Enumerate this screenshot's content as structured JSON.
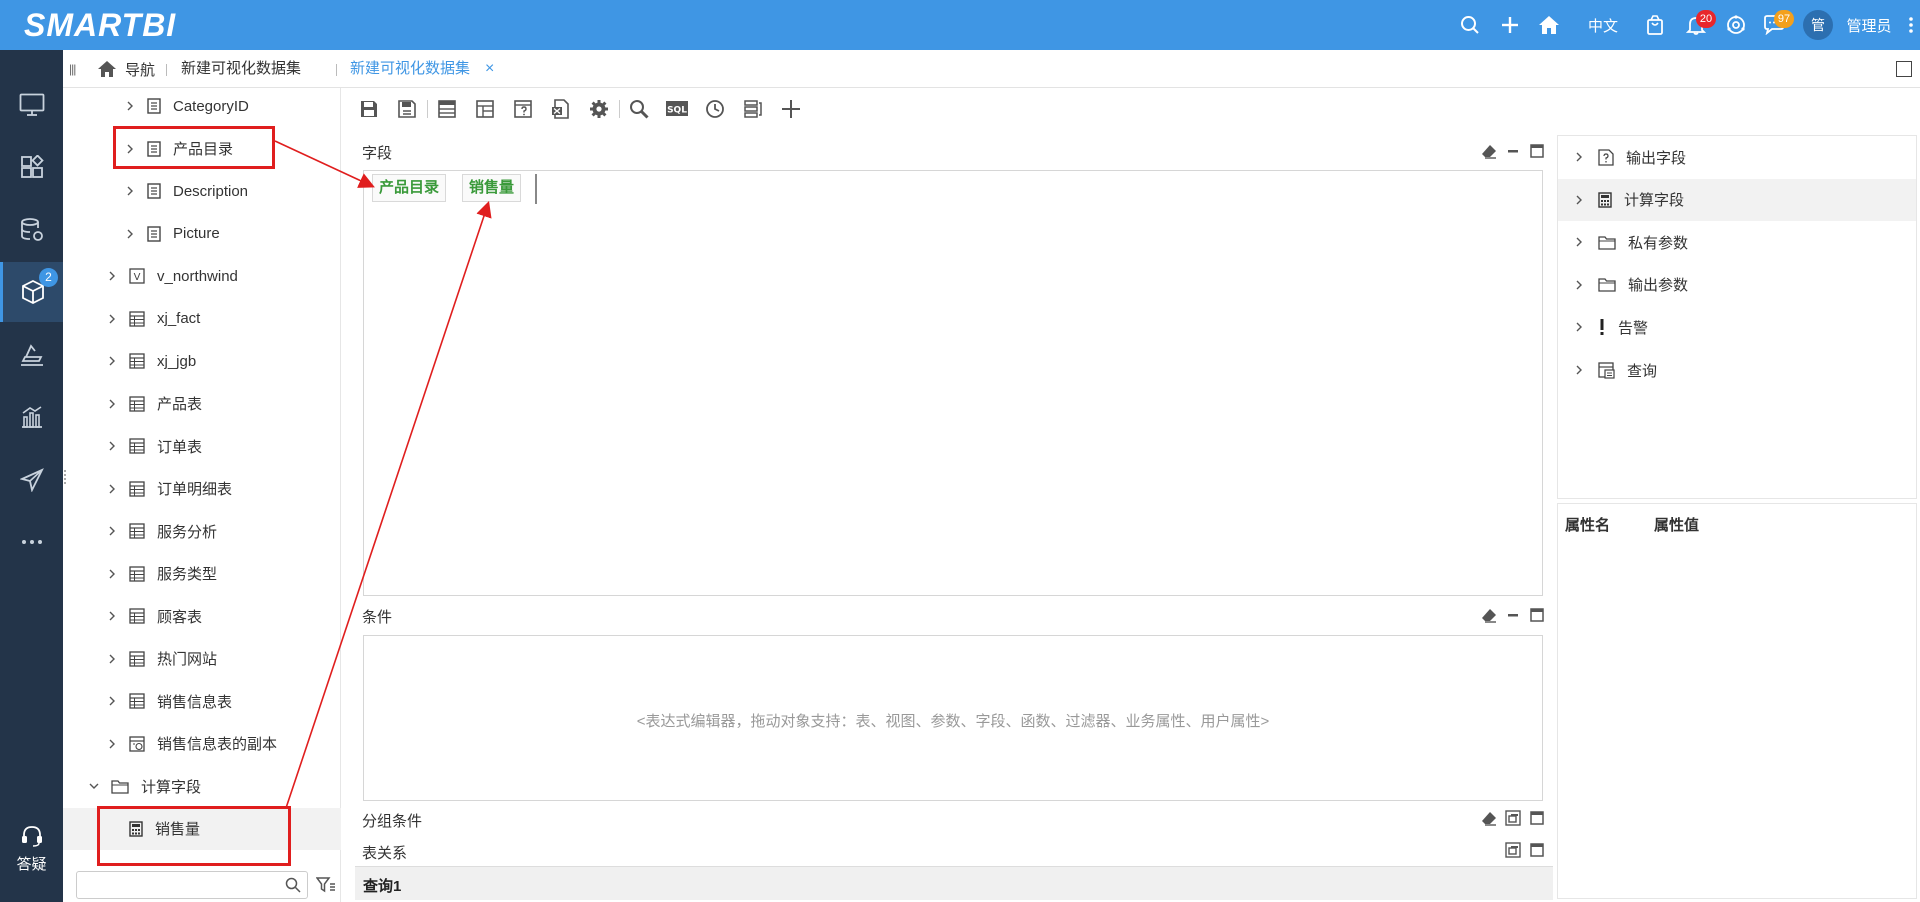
{
  "app": {
    "logo": "SMARTBI"
  },
  "header": {
    "language": "中文",
    "notifications_count": "20",
    "messages_count": "97",
    "avatar_text": "管",
    "user_name": "管理员"
  },
  "left_nav": {
    "resource_badge": "2",
    "help_label": "答疑",
    "items": [
      "monitor-icon",
      "dashboard-icon",
      "datasource-icon",
      "dataset-icon",
      "analysis-icon",
      "chart-icon",
      "publish-icon",
      "more-icon"
    ]
  },
  "tabs": {
    "home_label": "导航",
    "items": [
      {
        "label": "新建可视化数据集",
        "active": false
      },
      {
        "label": "新建可视化数据集",
        "active": true
      }
    ],
    "close_glyph": "×"
  },
  "tree": {
    "items": [
      {
        "label": "CategoryID",
        "icon": "field-icon",
        "level": 2,
        "expanded": false
      },
      {
        "label": "产品目录",
        "icon": "field-icon",
        "level": 2,
        "expanded": false
      },
      {
        "label": "Description",
        "icon": "field-icon",
        "level": 2,
        "expanded": false
      },
      {
        "label": "Picture",
        "icon": "field-icon",
        "level": 2,
        "expanded": false
      },
      {
        "label": "v_northwind",
        "icon": "view-icon",
        "level": 1,
        "expanded": false
      },
      {
        "label": "xj_fact",
        "icon": "table-icon",
        "level": 1,
        "expanded": false
      },
      {
        "label": "xj_jgb",
        "icon": "table-icon",
        "level": 1,
        "expanded": false
      },
      {
        "label": "产品表",
        "icon": "table-icon",
        "level": 1,
        "expanded": false
      },
      {
        "label": "订单表",
        "icon": "table-icon",
        "level": 1,
        "expanded": false
      },
      {
        "label": "订单明细表",
        "icon": "table-icon",
        "level": 1,
        "expanded": false
      },
      {
        "label": "服务分析",
        "icon": "table-icon",
        "level": 1,
        "expanded": false
      },
      {
        "label": "服务类型",
        "icon": "table-icon",
        "level": 1,
        "expanded": false
      },
      {
        "label": "顾客表",
        "icon": "table-icon",
        "level": 1,
        "expanded": false
      },
      {
        "label": "热门网站",
        "icon": "table-icon",
        "level": 1,
        "expanded": false
      },
      {
        "label": "销售信息表",
        "icon": "table-icon",
        "level": 1,
        "expanded": false
      },
      {
        "label": "销售信息表的副本",
        "icon": "table-copy-icon",
        "level": 1,
        "expanded": false
      },
      {
        "label": "计算字段",
        "icon": "folder-icon",
        "level": 0,
        "expanded": true
      },
      {
        "label": "销售量",
        "icon": "calculator-icon",
        "level": 1,
        "expanded": null,
        "selected": true
      }
    ],
    "search_placeholder": ""
  },
  "editor": {
    "fields_title": "字段",
    "field_chips": [
      "产品目录",
      "销售量"
    ],
    "conditions_title": "条件",
    "conditions_hint": "<表达式编辑器，拖动对象支持：表、视图、参数、字段、函数、过滤器、业务属性、用户属性>",
    "group_title": "分组条件",
    "relation_title": "表关系",
    "query_tab": "查询1"
  },
  "right_panel": {
    "items": [
      {
        "label": "输出字段",
        "icon": "output-field-icon"
      },
      {
        "label": "计算字段",
        "icon": "calculator-icon",
        "selected": true
      },
      {
        "label": "私有参数",
        "icon": "folder-icon"
      },
      {
        "label": "输出参数",
        "icon": "folder-icon"
      },
      {
        "label": "告警",
        "icon": "alert-icon"
      },
      {
        "label": "查询",
        "icon": "query-icon"
      }
    ],
    "props_name_header": "属性名",
    "props_value_header": "属性值"
  },
  "colors": {
    "header_bg": "#3f96e4",
    "nav_bg": "#233449",
    "chip_text": "#3a9a3a",
    "annotation": "#e01e1e",
    "active_tab": "#3f96e4"
  }
}
